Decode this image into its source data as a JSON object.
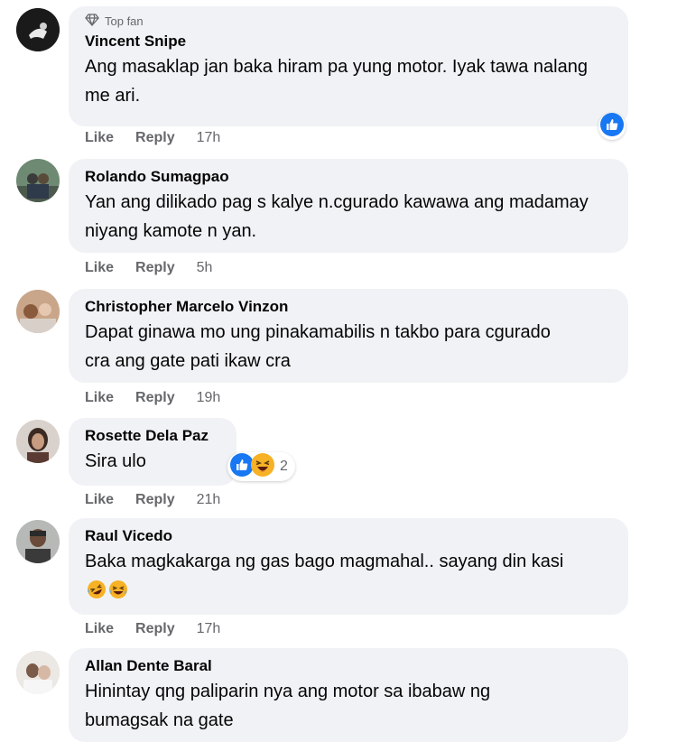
{
  "labels": {
    "like": "Like",
    "reply": "Reply"
  },
  "badge_icon": "diamond-icon",
  "comments": [
    {
      "author": "Vincent Snipe",
      "badge": "Top fan",
      "text": "Ang masaklap jan baka hiram pa yung motor. Iyak tawa nalang me ari.",
      "time": "17h",
      "reactions": [
        "like"
      ],
      "reaction_count": ""
    },
    {
      "author": "Rolando Sumagpao",
      "text": "Yan ang dilikado pag s kalye n.cgurado kawawa ang madamay niyang kamote n yan.",
      "time": "5h"
    },
    {
      "author": "Christopher Marcelo Vinzon",
      "text": "Dapat ginawa mo ung pinakamabilis n takbo para cgurado cra ang gate pati ikaw cra",
      "time": "19h"
    },
    {
      "author": "Rosette Dela Paz",
      "text": "Sira ulo",
      "time": "21h",
      "reactions": [
        "like",
        "haha"
      ],
      "reaction_count": "2"
    },
    {
      "author": "Raul Vicedo",
      "text": "Baka magkakarga ng gas bago magmahal.. sayang din kasi",
      "time": "17h",
      "inline_emoji": [
        "rofl",
        "laughing"
      ]
    },
    {
      "author": "Allan Dente Baral",
      "text": "Hinintay qng paliparin nya ang motor sa ibabaw ng bumagsak na gate"
    }
  ],
  "colors": {
    "bubble": "#f0f2f5",
    "meta": "#65676b",
    "like_blue": "#1877f2",
    "haha_yellow": "#f7b125"
  }
}
